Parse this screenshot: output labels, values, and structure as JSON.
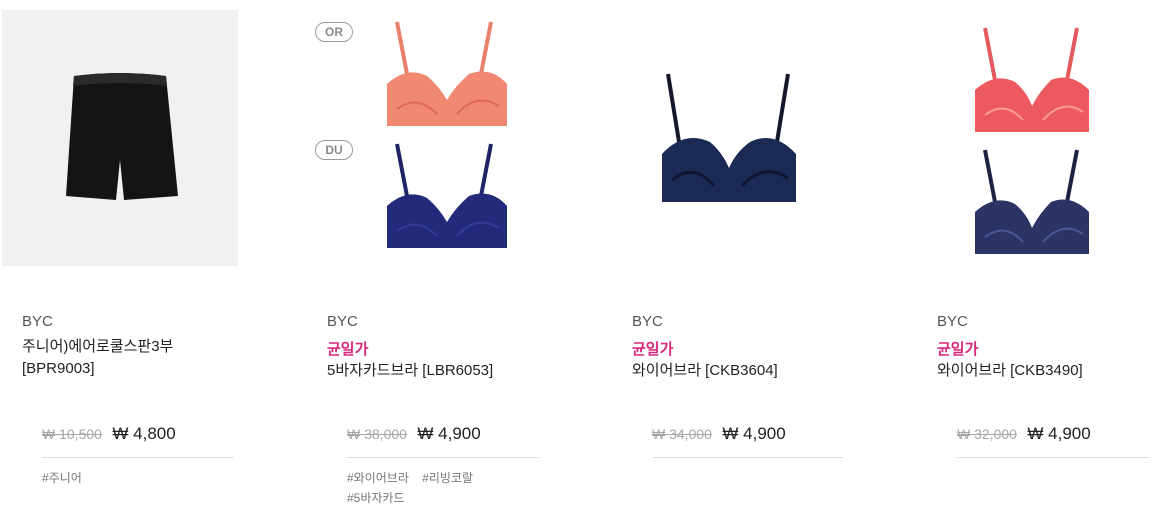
{
  "products": [
    {
      "brand": "BYC",
      "tagline": "",
      "name_line1": "주니어)에어로쿨스판3부",
      "name_line2": "[BPR9003]",
      "old_price": "₩ 10,500",
      "new_price": "₩ 4,800",
      "tags": [
        "#주니어"
      ],
      "color": "#111111"
    },
    {
      "brand": "BYC",
      "tagline": "균일가",
      "name_line1": "5바자카드브라 [LBR6053]",
      "old_price": "₩ 38,000",
      "new_price": "₩ 4,900",
      "tags": [
        "#와이어브라",
        "#리빙코랄",
        "#5바자카드"
      ],
      "variants": [
        {
          "code": "OR",
          "color": "#f08872"
        },
        {
          "code": "DU",
          "color": "#232a7a"
        }
      ]
    },
    {
      "brand": "BYC",
      "tagline": "균일가",
      "name_line1": "와이어브라 [CKB3604]",
      "old_price": "₩ 34,000",
      "new_price": "₩ 4,900",
      "tags": [],
      "color": "#1b2a55"
    },
    {
      "brand": "BYC",
      "tagline": "균일가",
      "name_line1": "와이어브라 [CKB3490]",
      "old_price": "₩ 32,000",
      "new_price": "₩ 4,900",
      "tags": [],
      "variants": [
        {
          "color": "#ec5a60"
        },
        {
          "color": "#2c3466"
        }
      ]
    }
  ]
}
